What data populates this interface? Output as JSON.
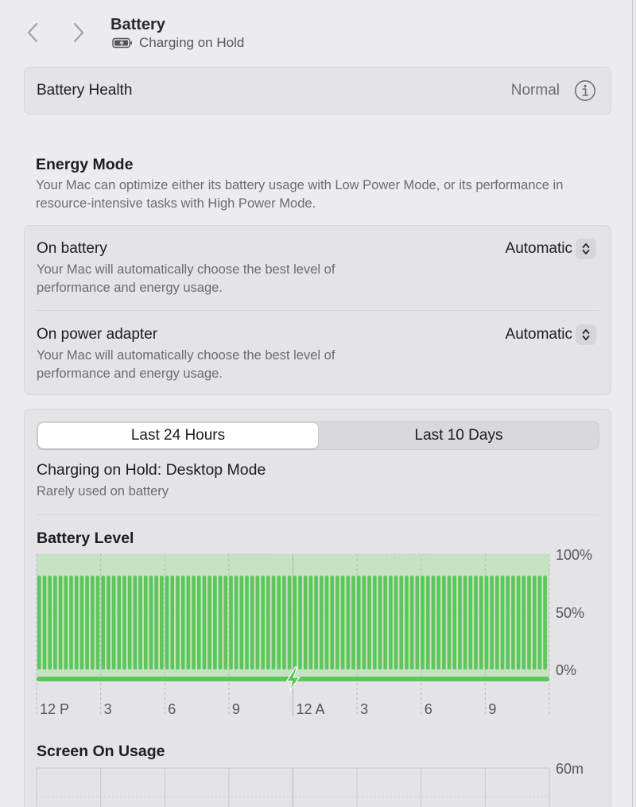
{
  "header": {
    "title": "Battery",
    "subtitle": "Charging on Hold"
  },
  "health": {
    "label": "Battery Health",
    "value": "Normal"
  },
  "energy_mode": {
    "title": "Energy Mode",
    "description": "Your Mac can optimize either its battery usage with Low Power Mode, or its performance in resource-intensive tasks with High Power Mode.",
    "rows": [
      {
        "title": "On battery",
        "description": "Your Mac will automatically choose the best level of performance and energy usage.",
        "value": "Automatic"
      },
      {
        "title": "On power adapter",
        "description": "Your Mac will automatically choose the best level of performance and energy usage.",
        "value": "Automatic"
      }
    ]
  },
  "usage": {
    "tabs": [
      "Last 24 Hours",
      "Last 10 Days"
    ],
    "selected_tab": "Last 24 Hours",
    "status_title": "Charging on Hold: Desktop Mode",
    "status_desc": "Rarely used on battery"
  },
  "colors": {
    "battery_green": "#5dc65a",
    "charging_band": "#c5e3c3"
  },
  "chart_data": [
    {
      "type": "bar",
      "title": "Battery Level",
      "y_ticks": [
        "100%",
        "50%",
        "0%"
      ],
      "ylim": [
        0,
        100
      ],
      "x_ticks": [
        "12 P",
        "3",
        "6",
        "9",
        "12 A",
        "3",
        "6",
        "9"
      ],
      "bar_count": 96,
      "values_percent": 80,
      "charging": true,
      "grid": true
    },
    {
      "type": "bar",
      "title": "Screen On Usage",
      "y_ticks": [
        "60m"
      ],
      "grid": true
    }
  ]
}
